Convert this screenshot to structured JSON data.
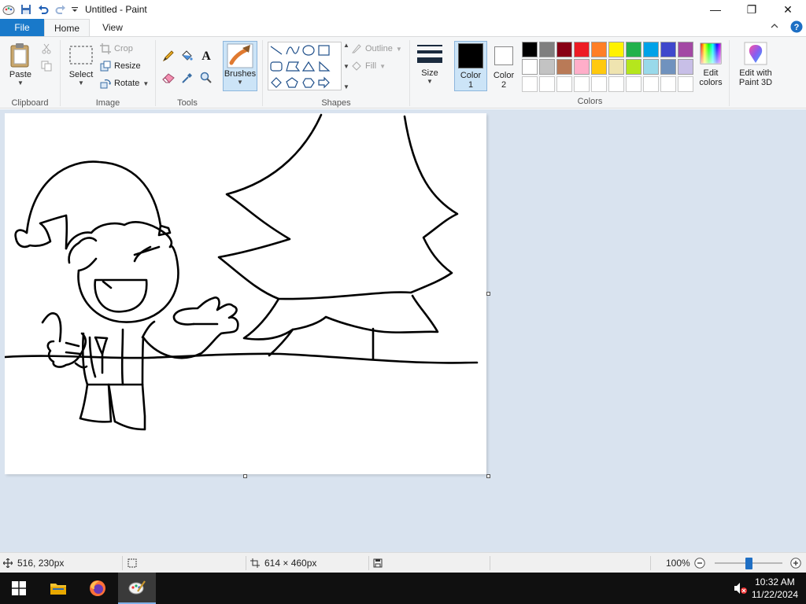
{
  "window": {
    "title": "Untitled - Paint",
    "controls": {
      "minimize": "—",
      "maximize": "❐",
      "close": "✕"
    }
  },
  "ribbon_tabs": {
    "file": "File",
    "home": "Home",
    "view": "View"
  },
  "clipboard": {
    "paste": "Paste",
    "group_label": "Clipboard"
  },
  "image": {
    "select": "Select",
    "crop": "Crop",
    "resize": "Resize",
    "rotate": "Rotate",
    "group_label": "Image"
  },
  "tools": {
    "group_label": "Tools"
  },
  "brushes": {
    "label": "Brushes"
  },
  "shapes": {
    "outline": "Outline",
    "fill": "Fill",
    "group_label": "Shapes"
  },
  "size": {
    "label": "Size"
  },
  "colors": {
    "color1_label": "Color\n1",
    "color1_line1": "Color",
    "color1_line2": "1",
    "color2_line1": "Color",
    "color2_line2": "2",
    "color1_value": "#000000",
    "color2_value": "#ffffff",
    "edit_colors_line1": "Edit",
    "edit_colors_line2": "colors",
    "group_label": "Colors",
    "palette_row1": [
      "#000000",
      "#7f7f7f",
      "#880015",
      "#ed1c24",
      "#ff7f27",
      "#fff200",
      "#22b14c",
      "#00a2e8",
      "#3f48cc",
      "#a349a4"
    ],
    "palette_row2": [
      "#ffffff",
      "#c3c3c3",
      "#b97a57",
      "#ffaec9",
      "#ffc90e",
      "#efe4b0",
      "#b5e61d",
      "#99d9ea",
      "#7092be",
      "#c8bfe7"
    ]
  },
  "paint3d": {
    "line1": "Edit with",
    "line2": "Paint 3D"
  },
  "status": {
    "cursor_pos": "516, 230px",
    "image_size": "614 × 460px",
    "zoom": "100%",
    "zoom_level": 0.5
  },
  "taskbar": {
    "time": "10:32 AM",
    "date": "11/22/2024"
  }
}
